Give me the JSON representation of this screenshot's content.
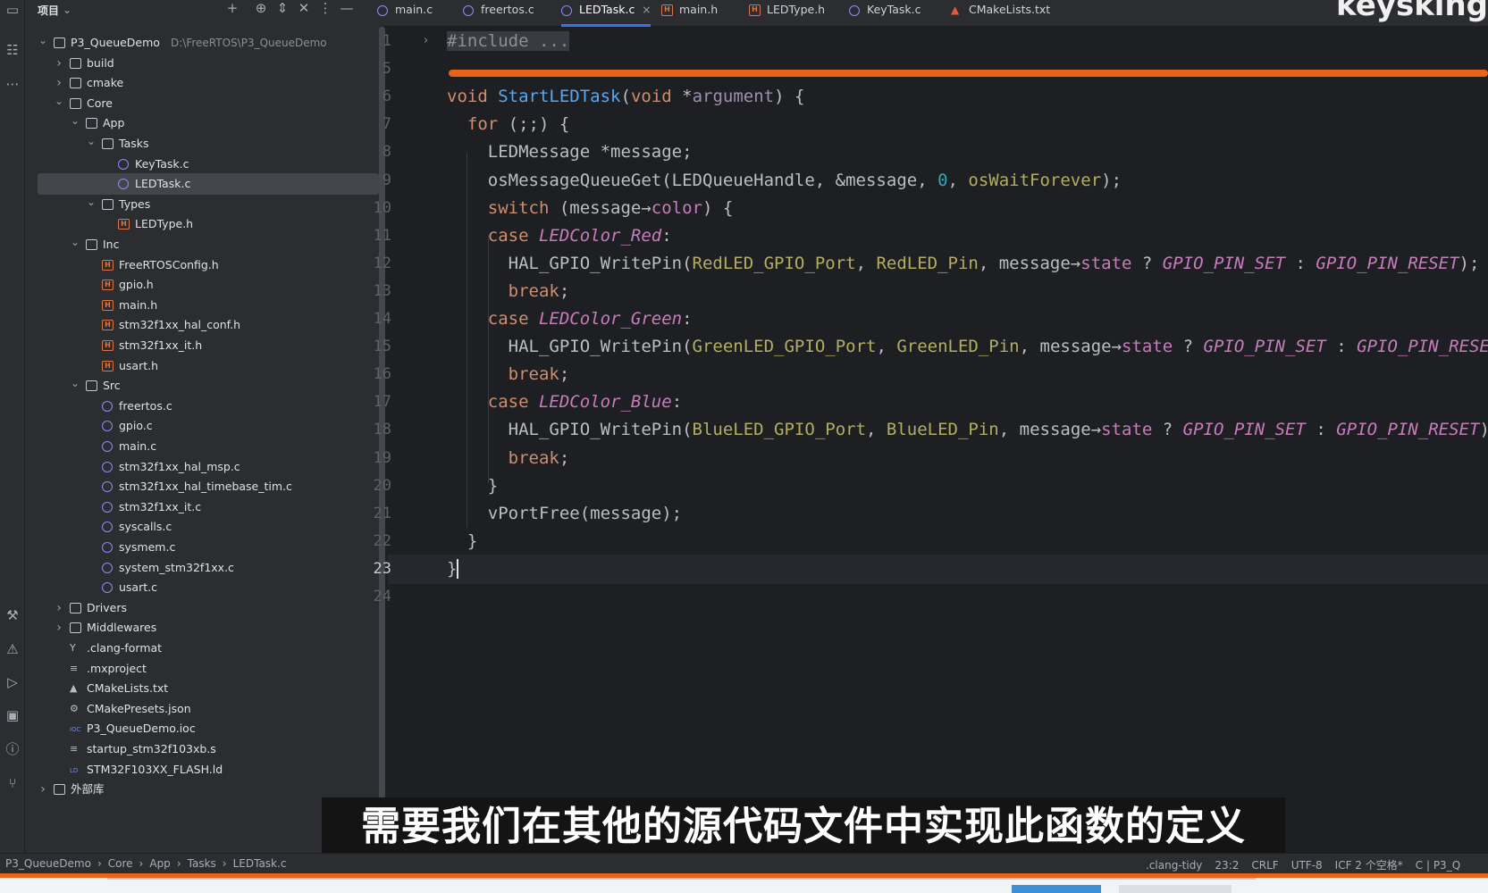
{
  "strip_icons": [
    "folder-icon",
    "structure-icon",
    "more-icon",
    "build-icon",
    "problems-icon",
    "run-icon",
    "terminal-icon",
    "notifications-icon",
    "git-icon"
  ],
  "project_panel": {
    "title": "项目",
    "title_chevron": "⌄",
    "toolbar": [
      "+",
      "⊕",
      "⇕",
      "✕",
      "⋮",
      "—"
    ]
  },
  "tree": [
    {
      "label": "P3_QueueDemo",
      "note": "D:\\FreeRTOS\\P3_QueueDemo",
      "type": "module",
      "depth": 0,
      "expanded": true
    },
    {
      "label": "build",
      "type": "folder",
      "depth": 1,
      "expanded": false
    },
    {
      "label": "cmake",
      "type": "folder",
      "depth": 1,
      "expanded": false
    },
    {
      "label": "Core",
      "type": "folder",
      "depth": 1,
      "expanded": true
    },
    {
      "label": "App",
      "type": "folder",
      "depth": 2,
      "expanded": true
    },
    {
      "label": "Tasks",
      "type": "folder",
      "depth": 3,
      "expanded": true
    },
    {
      "label": "KeyTask.c",
      "type": "c",
      "depth": 4
    },
    {
      "label": "LEDTask.c",
      "type": "c",
      "depth": 4,
      "selected": true
    },
    {
      "label": "Types",
      "type": "folder",
      "depth": 3,
      "expanded": true
    },
    {
      "label": "LEDType.h",
      "type": "h",
      "depth": 4
    },
    {
      "label": "Inc",
      "type": "folder",
      "depth": 2,
      "expanded": true
    },
    {
      "label": "FreeRTOSConfig.h",
      "type": "h",
      "depth": 3
    },
    {
      "label": "gpio.h",
      "type": "h",
      "depth": 3
    },
    {
      "label": "main.h",
      "type": "h",
      "depth": 3
    },
    {
      "label": "stm32f1xx_hal_conf.h",
      "type": "h",
      "depth": 3
    },
    {
      "label": "stm32f1xx_it.h",
      "type": "h",
      "depth": 3
    },
    {
      "label": "usart.h",
      "type": "h",
      "depth": 3
    },
    {
      "label": "Src",
      "type": "folder",
      "depth": 2,
      "expanded": true
    },
    {
      "label": "freertos.c",
      "type": "c",
      "depth": 3
    },
    {
      "label": "gpio.c",
      "type": "c",
      "depth": 3
    },
    {
      "label": "main.c",
      "type": "c",
      "depth": 3
    },
    {
      "label": "stm32f1xx_hal_msp.c",
      "type": "c",
      "depth": 3
    },
    {
      "label": "stm32f1xx_hal_timebase_tim.c",
      "type": "c",
      "depth": 3
    },
    {
      "label": "stm32f1xx_it.c",
      "type": "c",
      "depth": 3
    },
    {
      "label": "syscalls.c",
      "type": "c",
      "depth": 3
    },
    {
      "label": "sysmem.c",
      "type": "c",
      "depth": 3
    },
    {
      "label": "system_stm32f1xx.c",
      "type": "c",
      "depth": 3
    },
    {
      "label": "usart.c",
      "type": "c",
      "depth": 3
    },
    {
      "label": "Drivers",
      "type": "folder",
      "depth": 1,
      "expanded": false
    },
    {
      "label": "Middlewares",
      "type": "folder",
      "depth": 1,
      "expanded": false
    },
    {
      "label": ".clang-format",
      "type": "gen",
      "icon": "Y",
      "depth": 1
    },
    {
      "label": ".mxproject",
      "type": "gen",
      "icon": "≡",
      "depth": 1
    },
    {
      "label": "CMakeLists.txt",
      "type": "gen",
      "icon": "▲",
      "depth": 1
    },
    {
      "label": "CMakePresets.json",
      "type": "gen",
      "icon": "⚙",
      "depth": 1
    },
    {
      "label": "P3_QueueDemo.ioc",
      "type": "gen",
      "icon": "IOC",
      "depth": 1
    },
    {
      "label": "startup_stm32f103xb.s",
      "type": "gen",
      "icon": "≡",
      "depth": 1
    },
    {
      "label": "STM32F103XX_FLASH.ld",
      "type": "gen",
      "icon": "LD",
      "depth": 1
    },
    {
      "label": "外部库",
      "type": "lib",
      "depth": 0,
      "expanded": false
    }
  ],
  "tabs": [
    {
      "label": "main.c",
      "type": "c"
    },
    {
      "label": "freertos.c",
      "type": "c"
    },
    {
      "label": "LEDTask.c",
      "type": "c",
      "active": true,
      "close": "×"
    },
    {
      "label": "main.h",
      "type": "h"
    },
    {
      "label": "LEDType.h",
      "type": "h"
    },
    {
      "label": "KeyTask.c",
      "type": "c"
    },
    {
      "label": "CMakeLists.txt",
      "type": "cmake"
    }
  ],
  "watermark": "keysking",
  "editor": {
    "current_line": "23",
    "lines": [
      {
        "n": "1",
        "tokens": [
          [
            "inc",
            "#include ..."
          ]
        ],
        "fold": "›"
      },
      {
        "n": "5",
        "tokens": []
      },
      {
        "n": "6",
        "tokens": [
          [
            "kw",
            "void "
          ],
          [
            "fn",
            "StartLEDTask"
          ],
          [
            "",
            "("
          ],
          [
            "kw",
            "void "
          ],
          [
            "",
            "*"
          ],
          [
            "par",
            "argument"
          ],
          [
            "",
            ") {"
          ]
        ]
      },
      {
        "n": "7",
        "tokens": [
          [
            "",
            "  "
          ],
          [
            "kw",
            "for"
          ],
          [
            "",
            " (;;) {"
          ]
        ]
      },
      {
        "n": "8",
        "tokens": [
          [
            "",
            "    LEDMessage *message;"
          ]
        ]
      },
      {
        "n": "9",
        "tokens": [
          [
            "",
            "    osMessageQueueGet(LEDQueueHandle, &message, "
          ],
          [
            "num",
            "0"
          ],
          [
            "",
            ", "
          ],
          [
            "mac",
            "osWaitForever"
          ],
          [
            "",
            ");"
          ]
        ]
      },
      {
        "n": "10",
        "tokens": [
          [
            "",
            "    "
          ],
          [
            "kw",
            "switch"
          ],
          [
            "",
            " (message→"
          ],
          [
            "fld",
            "color"
          ],
          [
            "",
            ") {"
          ]
        ]
      },
      {
        "n": "11",
        "tokens": [
          [
            "",
            "    "
          ],
          [
            "kw",
            "case "
          ],
          [
            "en",
            "LEDColor_Red"
          ],
          [
            "",
            ":"
          ]
        ]
      },
      {
        "n": "12",
        "tokens": [
          [
            "",
            "      HAL_GPIO_WritePin("
          ],
          [
            "mac",
            "RedLED_GPIO_Port"
          ],
          [
            "",
            ", "
          ],
          [
            "mac",
            "RedLED_Pin"
          ],
          [
            "",
            ", message→"
          ],
          [
            "fld",
            "state"
          ],
          [
            "",
            " ? "
          ],
          [
            "en",
            "GPIO_PIN_SET"
          ],
          [
            "",
            " : "
          ],
          [
            "en",
            "GPIO_PIN_RESET"
          ],
          [
            "",
            ");"
          ]
        ]
      },
      {
        "n": "13",
        "tokens": [
          [
            "",
            "      "
          ],
          [
            "kw",
            "break"
          ],
          [
            "",
            ";"
          ]
        ]
      },
      {
        "n": "14",
        "tokens": [
          [
            "",
            "    "
          ],
          [
            "kw",
            "case "
          ],
          [
            "en",
            "LEDColor_Green"
          ],
          [
            "",
            ":"
          ]
        ]
      },
      {
        "n": "15",
        "tokens": [
          [
            "",
            "      HAL_GPIO_WritePin("
          ],
          [
            "mac",
            "GreenLED_GPIO_Port"
          ],
          [
            "",
            ", "
          ],
          [
            "mac",
            "GreenLED_Pin"
          ],
          [
            "",
            ", message→"
          ],
          [
            "fld",
            "state"
          ],
          [
            "",
            " ? "
          ],
          [
            "en",
            "GPIO_PIN_SET"
          ],
          [
            "",
            " : "
          ],
          [
            "en",
            "GPIO_PIN_RESET"
          ],
          [
            "",
            ");"
          ]
        ]
      },
      {
        "n": "16",
        "tokens": [
          [
            "",
            "      "
          ],
          [
            "kw",
            "break"
          ],
          [
            "",
            ";"
          ]
        ]
      },
      {
        "n": "17",
        "tokens": [
          [
            "",
            "    "
          ],
          [
            "kw",
            "case "
          ],
          [
            "en",
            "LEDColor_Blue"
          ],
          [
            "",
            ":"
          ]
        ]
      },
      {
        "n": "18",
        "tokens": [
          [
            "",
            "      HAL_GPIO_WritePin("
          ],
          [
            "mac",
            "BlueLED_GPIO_Port"
          ],
          [
            "",
            ", "
          ],
          [
            "mac",
            "BlueLED_Pin"
          ],
          [
            "",
            ", message→"
          ],
          [
            "fld",
            "state"
          ],
          [
            "",
            " ? "
          ],
          [
            "en",
            "GPIO_PIN_SET"
          ],
          [
            "",
            " : "
          ],
          [
            "en",
            "GPIO_PIN_RESET"
          ],
          [
            "",
            ");"
          ]
        ]
      },
      {
        "n": "19",
        "tokens": [
          [
            "",
            "      "
          ],
          [
            "kw",
            "break"
          ],
          [
            "",
            ";"
          ]
        ]
      },
      {
        "n": "20",
        "tokens": [
          [
            "",
            "    }"
          ]
        ]
      },
      {
        "n": "21",
        "tokens": [
          [
            "",
            "    vPortFree(message);"
          ]
        ]
      },
      {
        "n": "22",
        "tokens": [
          [
            "",
            "  }"
          ]
        ]
      },
      {
        "n": "23",
        "tokens": [
          [
            "",
            "}"
          ]
        ],
        "cursor": true
      },
      {
        "n": "24",
        "tokens": []
      }
    ]
  },
  "subtitle": "需要我们在其他的源代码文件中实现此函数的定义",
  "status": {
    "breadcrumb": [
      "P3_QueueDemo",
      "Core",
      "App",
      "Tasks",
      "LEDTask.c"
    ],
    "breadcrumb_sep": "›",
    "right": [
      ".clang-tidy",
      "23:2",
      "CRLF",
      "UTF-8",
      "ICF 2 个空格*",
      "C | P3_Q"
    ]
  },
  "colors": {
    "accent": "#3574f0",
    "marker": "#e8621a",
    "keyword": "#cf8e6d",
    "function": "#56a8f5",
    "macro": "#b3ae60",
    "enum": "#c77dbb",
    "number": "#2aacb8"
  }
}
